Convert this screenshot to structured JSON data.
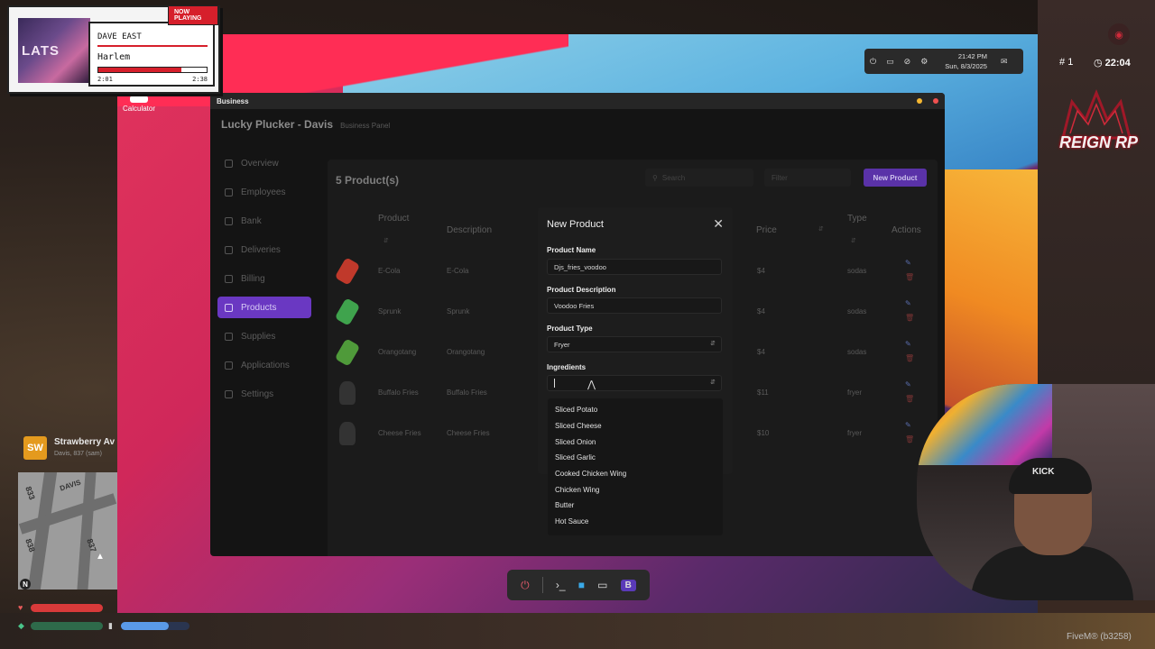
{
  "now_playing": {
    "badge": "NOW PLAYING",
    "album_art_text": "LATS",
    "artist": "DAVE EAST",
    "song": "Harlem",
    "elapsed": "2:01",
    "duration": "2:38",
    "progress": 0.77
  },
  "desktop": {
    "calculator_label": "Calculator"
  },
  "window": {
    "title": "Business",
    "business_name": "Lucky Plucker - Davis",
    "business_sub": "Business Panel"
  },
  "sidebar": {
    "items": [
      {
        "label": "Overview",
        "icon": "overview-icon"
      },
      {
        "label": "Employees",
        "icon": "employees-icon"
      },
      {
        "label": "Bank",
        "icon": "bank-icon"
      },
      {
        "label": "Deliveries",
        "icon": "deliveries-icon"
      },
      {
        "label": "Billing",
        "icon": "billing-icon"
      },
      {
        "label": "Products",
        "icon": "products-icon",
        "active": true
      },
      {
        "label": "Supplies",
        "icon": "supplies-icon"
      },
      {
        "label": "Applications",
        "icon": "applications-icon"
      },
      {
        "label": "Settings",
        "icon": "settings-icon"
      }
    ]
  },
  "products": {
    "count_title": "5 Product(s)",
    "search_placeholder": "Search",
    "filter_placeholder": "Filter",
    "new_button": "New Product",
    "columns": {
      "product": "Product",
      "description": "Description",
      "price": "Price",
      "type": "Type",
      "actions": "Actions"
    },
    "rows": [
      {
        "name": "E-Cola",
        "description": "E-Cola",
        "price": "$4",
        "type": "sodas",
        "color": "#c0392b"
      },
      {
        "name": "Sprunk",
        "description": "Sprunk",
        "price": "$4",
        "type": "sodas",
        "color": "#3fa34d"
      },
      {
        "name": "Orangotang",
        "description": "Orangotang",
        "price": "$4",
        "type": "sodas",
        "color": "#4f9a3a"
      },
      {
        "name": "Buffalo Fries",
        "description": "Buffalo Fries",
        "price": "$11",
        "type": "fryer",
        "color": "#3a3a3a"
      },
      {
        "name": "Cheese Fries",
        "description": "Cheese Fries",
        "price": "$10",
        "type": "fryer",
        "color": "#3a3a3a"
      }
    ]
  },
  "modal": {
    "title": "New Product",
    "name_label": "Product Name",
    "name_value": "Djs_fries_voodoo",
    "desc_label": "Product Description",
    "desc_value": "Voodoo Fries",
    "type_label": "Product Type",
    "type_value": "Fryer",
    "ingredients_label": "Ingredients",
    "ingredient_options": [
      "Sliced Potato",
      "Sliced Cheese",
      "Sliced Onion",
      "Sliced Garlic",
      "Cooked Chicken Wing",
      "Chicken Wing",
      "Butter",
      "Hot Sauce"
    ]
  },
  "tray": {
    "time": "21:42 PM",
    "date": "Sun, 8/3/2025"
  },
  "hud": {
    "player_id": "1",
    "clock": "22:04",
    "server_logo": "REIGN RP",
    "client": "FiveM® (b3258)"
  },
  "location": {
    "badge": "SW",
    "street": "Strawberry Av",
    "area": "Davis, 837 (sam)",
    "map_north": "N",
    "map_labels": [
      "833",
      "837",
      "838"
    ],
    "map_road": "DAVIS"
  },
  "status": {
    "health": 1.0,
    "armor": 1.0,
    "stamina": 0.7
  },
  "webcam": {
    "cap_text": "KICK"
  },
  "colors": {
    "accent": "#6a38c2",
    "modal_bg": "#1d1d1d",
    "now_playing_red": "#d61f2b"
  }
}
